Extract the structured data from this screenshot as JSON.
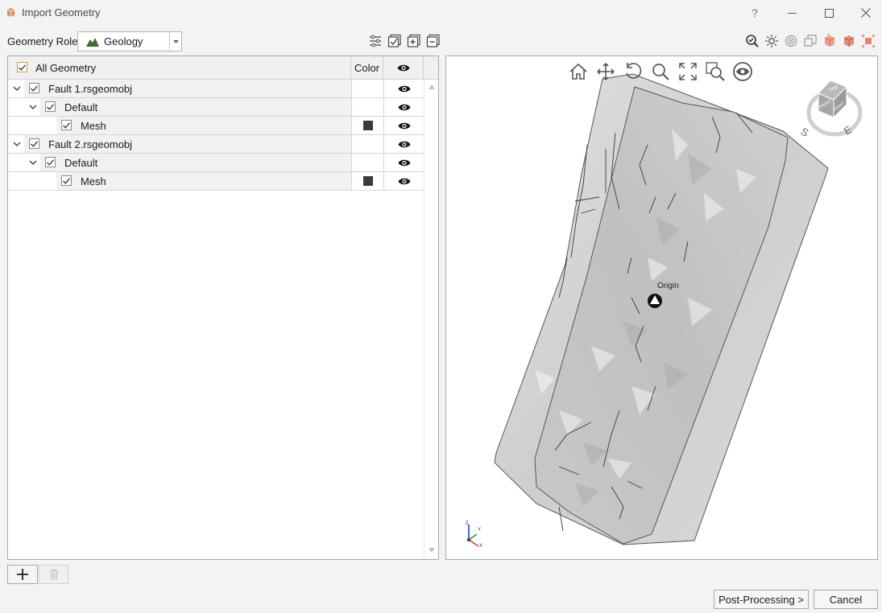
{
  "window": {
    "title": "Import Geometry",
    "help_glyph": "?",
    "accent": "#e1b07a"
  },
  "toolbar": {
    "role_label": "Geometry Role:",
    "role_value": "Geology",
    "role_icon": "mountain-icon"
  },
  "tree": {
    "header": {
      "all_label": "All Geometry",
      "color_label": "Color",
      "visibility_icon": "eye-icon"
    },
    "rows": [
      {
        "label": "Fault 1.rsgeomobj",
        "level": 0,
        "checked": true,
        "expanded": true,
        "visible": true
      },
      {
        "label": "Default",
        "level": 1,
        "checked": true,
        "expanded": true,
        "visible": true
      },
      {
        "label": "Mesh",
        "level": 2,
        "checked": true,
        "color": "#3a3a3a",
        "visible": true
      },
      {
        "label": "Fault 2.rsgeomobj",
        "level": 0,
        "checked": true,
        "expanded": true,
        "visible": true
      },
      {
        "label": "Default",
        "level": 1,
        "checked": true,
        "expanded": true,
        "visible": true
      },
      {
        "label": "Mesh",
        "level": 2,
        "checked": true,
        "color": "#3a3a3a",
        "visible": true
      }
    ]
  },
  "viewport": {
    "origin_label": "Origin",
    "cube_labels": {
      "top": "TOP",
      "front": "FRONT",
      "right": "RIGHT",
      "south": "S",
      "east": "E"
    },
    "axis_labels": {
      "x": "X",
      "y": "Y",
      "z": "Z"
    },
    "mesh_color": "#c8c8c8"
  },
  "footer": {
    "post_processing_label": "Post-Processing >",
    "cancel_label": "Cancel"
  }
}
